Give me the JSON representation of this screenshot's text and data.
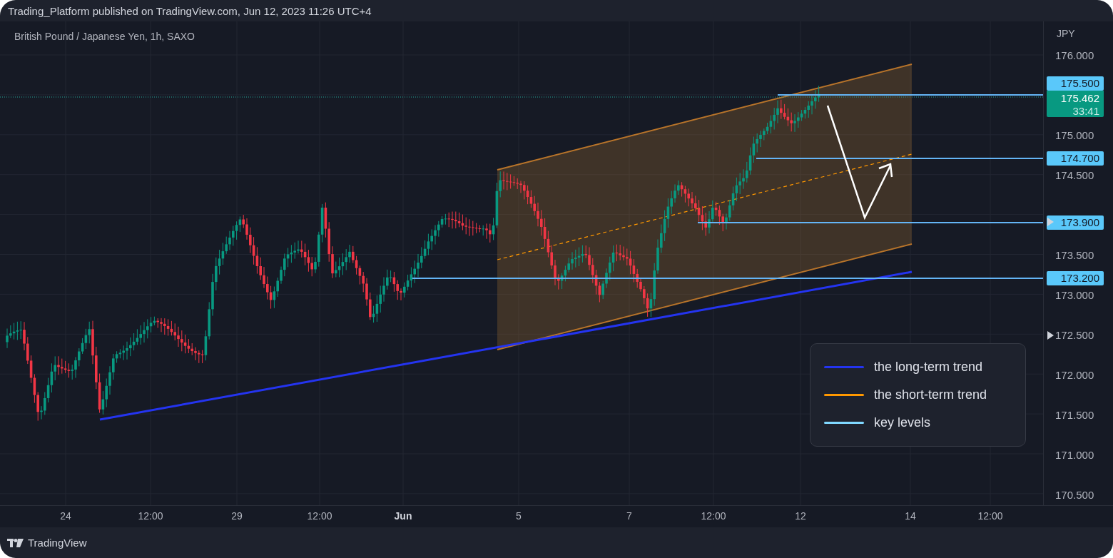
{
  "header": {
    "title": "Trading_Platform published on TradingView.com, Jun 12, 2023 11:26 UTC+4"
  },
  "chart": {
    "symbol": "British Pound / Japanese Yen, 1h, SAXO",
    "currency": "JPY",
    "price_ticks": [
      "176.000",
      "175.000",
      "174.500",
      "173.500",
      "173.000",
      "172.500",
      "172.000",
      "171.500",
      "171.000",
      "170.500"
    ],
    "key_levels": [
      {
        "label": "175.500"
      },
      {
        "label": "174.700"
      },
      {
        "label": "173.900"
      },
      {
        "label": "173.200"
      }
    ],
    "current_price": {
      "price": "175.462",
      "countdown": "33:41"
    },
    "time_labels": [
      {
        "label": "24",
        "bold": false
      },
      {
        "label": "12:00",
        "bold": false
      },
      {
        "label": "29",
        "bold": false
      },
      {
        "label": "12:00",
        "bold": false
      },
      {
        "label": "Jun",
        "bold": true
      },
      {
        "label": "5",
        "bold": false
      },
      {
        "label": "7",
        "bold": false
      },
      {
        "label": "12:00",
        "bold": false
      },
      {
        "label": "12",
        "bold": false
      },
      {
        "label": "14",
        "bold": false
      },
      {
        "label": "12:00",
        "bold": false
      }
    ],
    "legend": [
      {
        "label": "the long-term trend",
        "color": "#2434f0"
      },
      {
        "label": "the short-term trend",
        "color": "#ff9800"
      },
      {
        "label": "key levels",
        "color": "#80d8ff"
      }
    ]
  },
  "footer": {
    "brand": "TradingView"
  }
}
